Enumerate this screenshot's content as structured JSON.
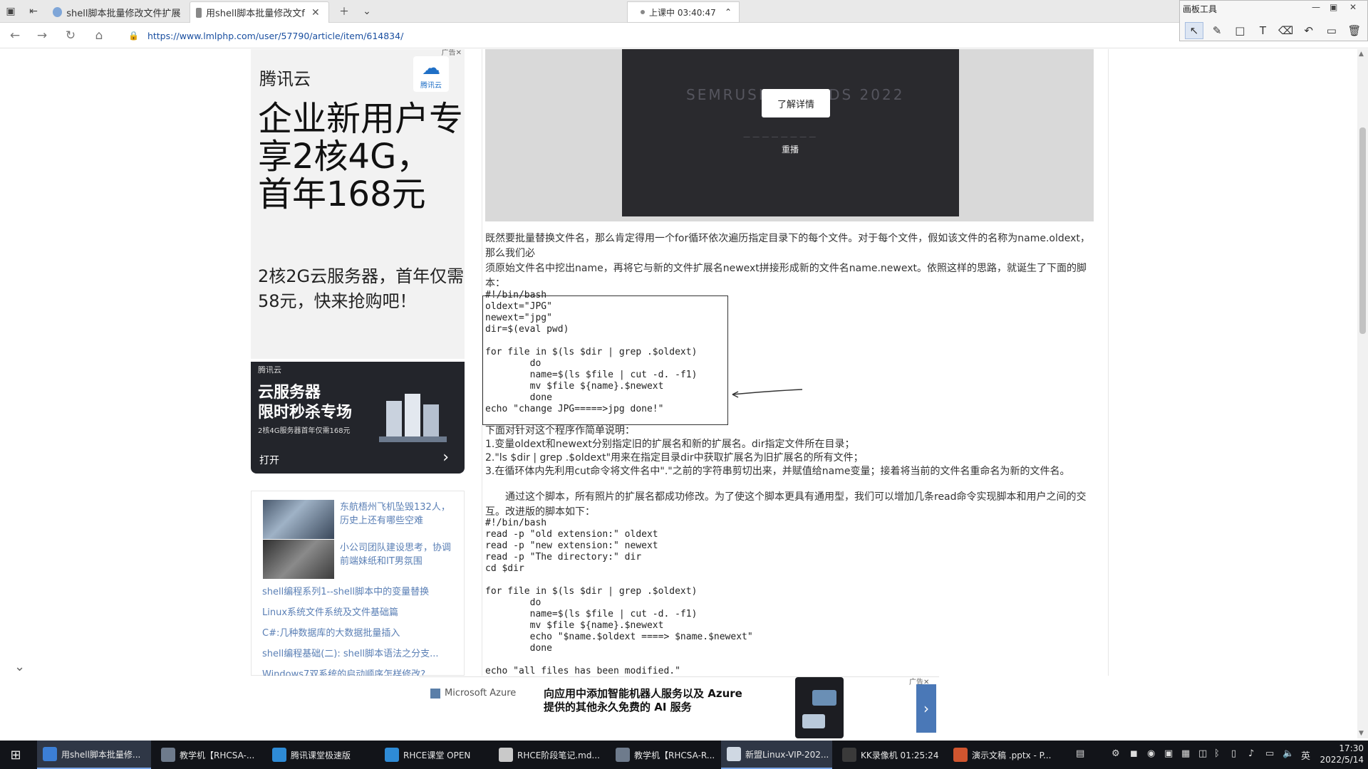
{
  "browser": {
    "tabs": [
      {
        "label": "shell脚本批量修改文件扩展",
        "active": false
      },
      {
        "label": "用shell脚本批量修改文f",
        "active": true
      }
    ],
    "new_tab_icon": "plus-icon",
    "recording": {
      "label": "上课中 03:40:47"
    },
    "url": "https://www.lmlphp.com/user/57790/article/item/614834/"
  },
  "draw_tool": {
    "title": "画板工具",
    "tools": [
      "pointer-icon",
      "pen-icon",
      "rect-icon",
      "text-icon",
      "eraser-icon",
      "undo-icon",
      "screen-icon",
      "trash-icon"
    ]
  },
  "sidebar": {
    "ad_brand": "腾讯云",
    "ad_logo_text": "腾讯云",
    "ad_headline": "企业新用户专享2核4G，首年168元",
    "ad_sub": "2核2G云服务器，首年仅需58元，快来抢购吧！",
    "ad2": {
      "logo": "腾讯云",
      "title_line1": "云服务器",
      "title_line2": "限时秒杀专场",
      "desc": "2核4G服务器首年仅需168元",
      "open": "打开"
    },
    "related": [
      {
        "caption": "东航梧州飞机坠毁132人，历史上还有哪些空难"
      },
      {
        "caption": "小公司团队建设思考，协调前端妹纸和IT男氛围"
      }
    ],
    "links": [
      "shell编程系列1--shell脚本中的变量替换",
      "Linux系统文件系统及文件基础篇",
      "C#:几种数据库的大数据批量插入",
      "shell编程基础(二): shell脚本语法之分支...",
      "Windows7双系统的启动顺序怎样修改?"
    ]
  },
  "video": {
    "ghost_text": "SEMRUSH AWARDS 2022",
    "learn_more": "了解详情",
    "replay": "重播"
  },
  "article": {
    "p1": "既然要批量替换文件名，那么肯定得用一个for循环依次遍历指定目录下的每个文件。对于每个文件，假如该文件的名称为name.oldext，那么我们必",
    "p2": "须原始文件名中挖出name，再将它与新的文件扩展名newext拼接形成新的文件名name.newext。依照这样的思路，就诞生了下面的脚本：",
    "code1": "#!/bin/bash\noldext=\"JPG\"\nnewext=\"jpg\"\ndir=$(eval pwd)\n\nfor file in $(ls $dir | grep .$oldext)\n        do\n        name=$(ls $file | cut -d. -f1)\n        mv $file ${name}.$newext\n        done\necho \"change JPG=====>jpg done!\"",
    "p3": "下面对针对这个程序作简单说明：",
    "p4": "1.变量oldext和newext分别指定旧的扩展名和新的扩展名。dir指定文件所在目录；",
    "p5": "2.\"ls $dir | grep .$oldext\"用来在指定目录dir中获取扩展名为旧扩展名的所有文件；",
    "p6": "3.在循环体内先利用cut命令将文件名中\".\"之前的字符串剪切出来，并赋值给name变量；接着将当前的文件名重命名为新的文件名。",
    "p7": "通过这个脚本，所有照片的扩展名都成功修改。为了使这个脚本更具有通用型，我们可以增加几条read命令实现脚本和用户之间的交互。改进版的脚本如下：",
    "code2": "#!/bin/bash\nread -p \"old extension:\" oldext\nread -p \"new extension:\" newext\nread -p \"The directory:\" dir\ncd $dir\n\nfor file in $(ls $dir | grep .$oldext)\n        do\n        name=$(ls $file | cut -d. -f1)\n        mv $file ${name}.$newext\n        echo \"$name.$oldext ====> $name.$newext\"\n        done\n\necho \"all files has been modified.\""
  },
  "bottom_ad": {
    "brand": "Microsoft Azure",
    "line1": "向应用中添加智能机器人服务以及 Azure",
    "line2": "提供的其他永久免费的 AI 服务",
    "tag": "广告"
  },
  "taskbar": {
    "items": [
      {
        "label": "用shell脚本批量修...",
        "active": true,
        "color": "#3c7fd6"
      },
      {
        "label": "教学机【RHCSA-...",
        "active": false,
        "color": "#6e7b8c"
      },
      {
        "label": "腾讯课堂极速版",
        "active": false,
        "color": "#2e8bd6"
      },
      {
        "label": "RHCE课堂 OPEN",
        "active": false,
        "color": "#2e8bd6"
      },
      {
        "label": "RHCE阶段笔记.md...",
        "active": false,
        "color": "#c9c9c9"
      },
      {
        "label": "教学机【RHCSA-R...",
        "active": false,
        "color": "#6e7b8c"
      },
      {
        "label": "新盟Linux-VIP-202...",
        "active": true,
        "color": "#cfd8e3"
      },
      {
        "label": "KK录像机 01:25:24",
        "active": false,
        "color": "#3a3a3a"
      },
      {
        "label": "演示文稿 .pptx - P...",
        "active": false,
        "color": "#d0552f"
      }
    ],
    "ime": "英",
    "time": "17:30",
    "date": "2022/5/14"
  }
}
